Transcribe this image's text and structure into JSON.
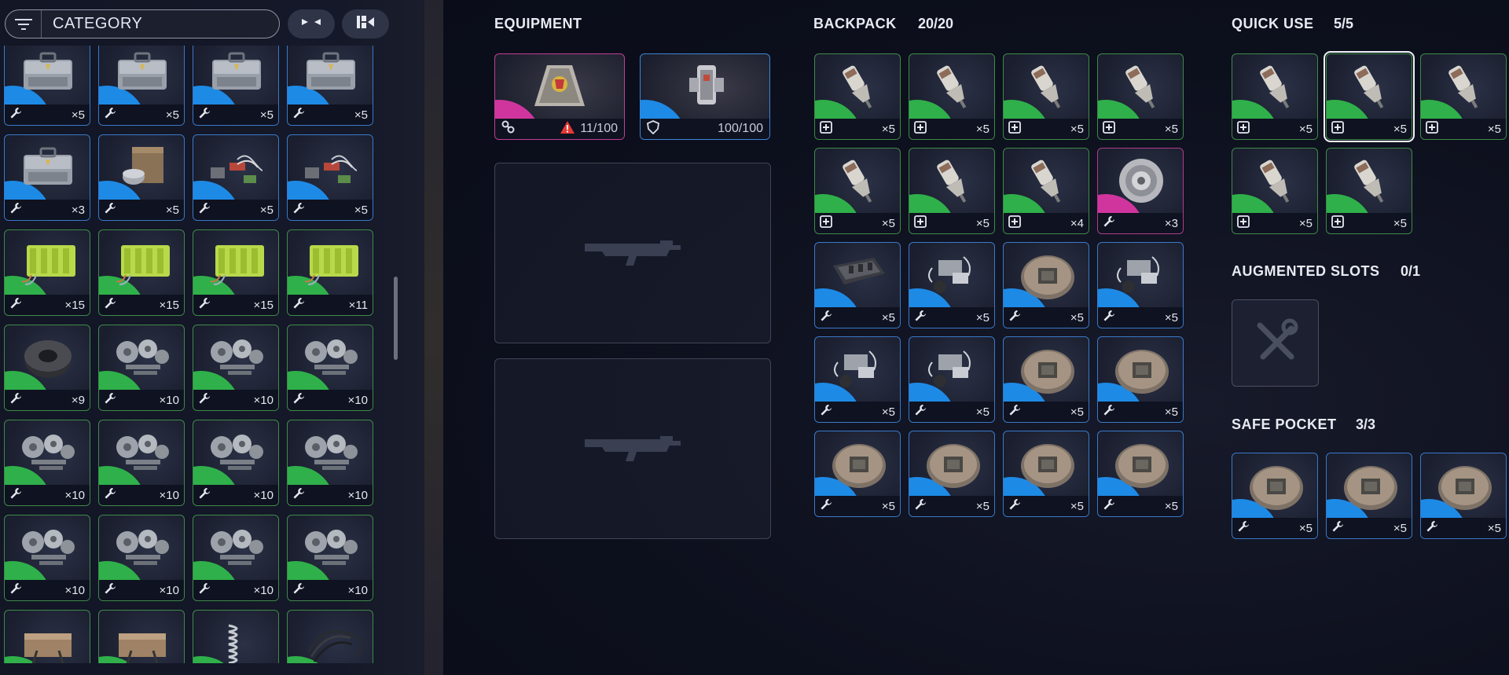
{
  "stash": {
    "category_label": "CATEGORY",
    "items": [
      {
        "rarity": "blue",
        "icon": "toolbox",
        "type": "wrench",
        "count": "×5"
      },
      {
        "rarity": "blue",
        "icon": "toolbox",
        "type": "wrench",
        "count": "×5"
      },
      {
        "rarity": "blue",
        "icon": "toolbox",
        "type": "wrench",
        "count": "×5"
      },
      {
        "rarity": "blue",
        "icon": "toolbox",
        "type": "wrench",
        "count": "×5"
      },
      {
        "rarity": "blue",
        "icon": "toolbox",
        "type": "wrench",
        "count": "×3"
      },
      {
        "rarity": "blue",
        "icon": "box-canister",
        "type": "wrench",
        "count": "×5"
      },
      {
        "rarity": "blue",
        "icon": "wires",
        "type": "wrench",
        "count": "×5"
      },
      {
        "rarity": "blue",
        "icon": "wires",
        "type": "wrench",
        "count": "×5"
      },
      {
        "rarity": "green",
        "icon": "battery",
        "type": "wrench",
        "count": "×15"
      },
      {
        "rarity": "green",
        "icon": "battery",
        "type": "wrench",
        "count": "×15"
      },
      {
        "rarity": "green",
        "icon": "battery",
        "type": "wrench",
        "count": "×15"
      },
      {
        "rarity": "green",
        "icon": "battery",
        "type": "wrench",
        "count": "×11"
      },
      {
        "rarity": "green",
        "icon": "tape",
        "type": "wrench",
        "count": "×9"
      },
      {
        "rarity": "green",
        "icon": "gears",
        "type": "wrench",
        "count": "×10"
      },
      {
        "rarity": "green",
        "icon": "gears",
        "type": "wrench",
        "count": "×10"
      },
      {
        "rarity": "green",
        "icon": "gears",
        "type": "wrench",
        "count": "×10"
      },
      {
        "rarity": "green",
        "icon": "gears",
        "type": "wrench",
        "count": "×10"
      },
      {
        "rarity": "green",
        "icon": "gears",
        "type": "wrench",
        "count": "×10"
      },
      {
        "rarity": "green",
        "icon": "gears",
        "type": "wrench",
        "count": "×10"
      },
      {
        "rarity": "green",
        "icon": "gears",
        "type": "wrench",
        "count": "×10"
      },
      {
        "rarity": "green",
        "icon": "gears",
        "type": "wrench",
        "count": "×10"
      },
      {
        "rarity": "green",
        "icon": "gears",
        "type": "wrench",
        "count": "×10"
      },
      {
        "rarity": "green",
        "icon": "gears",
        "type": "wrench",
        "count": "×10"
      },
      {
        "rarity": "green",
        "icon": "gears",
        "type": "wrench",
        "count": "×10"
      },
      {
        "rarity": "green",
        "icon": "bag",
        "type": "none",
        "count": ""
      },
      {
        "rarity": "green",
        "icon": "bag",
        "type": "none",
        "count": ""
      },
      {
        "rarity": "green",
        "icon": "spring",
        "type": "none",
        "count": ""
      },
      {
        "rarity": "green",
        "icon": "cables",
        "type": "none",
        "count": ""
      }
    ]
  },
  "equipment": {
    "title": "EQUIPMENT",
    "augment": {
      "value": "11/100"
    },
    "shield": {
      "value": "100/100"
    }
  },
  "backpack": {
    "title": "BACKPACK",
    "count": "20/20",
    "items": [
      {
        "rarity": "green",
        "icon": "injector",
        "type": "med",
        "count": "×5"
      },
      {
        "rarity": "green",
        "icon": "injector",
        "type": "med",
        "count": "×5"
      },
      {
        "rarity": "green",
        "icon": "injector",
        "type": "med",
        "count": "×5"
      },
      {
        "rarity": "green",
        "icon": "injector",
        "type": "med",
        "count": "×5"
      },
      {
        "rarity": "green",
        "icon": "injector",
        "type": "med",
        "count": "×5"
      },
      {
        "rarity": "green",
        "icon": "injector",
        "type": "med",
        "count": "×5"
      },
      {
        "rarity": "green",
        "icon": "injector",
        "type": "med",
        "count": "×4"
      },
      {
        "rarity": "pink",
        "icon": "motor",
        "type": "wrench",
        "count": "×3"
      },
      {
        "rarity": "blue",
        "icon": "tray",
        "type": "wrench",
        "count": "×5"
      },
      {
        "rarity": "blue",
        "icon": "parts",
        "type": "wrench",
        "count": "×5"
      },
      {
        "rarity": "blue",
        "icon": "chipdisk",
        "type": "wrench",
        "count": "×5"
      },
      {
        "rarity": "blue",
        "icon": "parts",
        "type": "wrench",
        "count": "×5"
      },
      {
        "rarity": "blue",
        "icon": "parts",
        "type": "wrench",
        "count": "×5"
      },
      {
        "rarity": "blue",
        "icon": "parts",
        "type": "wrench",
        "count": "×5"
      },
      {
        "rarity": "blue",
        "icon": "chipdisk",
        "type": "wrench",
        "count": "×5"
      },
      {
        "rarity": "blue",
        "icon": "chipdisk",
        "type": "wrench",
        "count": "×5"
      },
      {
        "rarity": "blue",
        "icon": "chipdisk",
        "type": "wrench",
        "count": "×5"
      },
      {
        "rarity": "blue",
        "icon": "chipdisk",
        "type": "wrench",
        "count": "×5"
      },
      {
        "rarity": "blue",
        "icon": "chipdisk",
        "type": "wrench",
        "count": "×5"
      },
      {
        "rarity": "blue",
        "icon": "chipdisk",
        "type": "wrench",
        "count": "×5"
      }
    ]
  },
  "quick_use": {
    "title": "QUICK USE",
    "count": "5/5",
    "items": [
      {
        "rarity": "green",
        "icon": "injector",
        "type": "med",
        "count": "×5"
      },
      {
        "rarity": "green",
        "icon": "injector",
        "type": "med",
        "count": "×5",
        "selected": true
      },
      {
        "rarity": "green",
        "icon": "injector",
        "type": "med",
        "count": "×5"
      },
      {
        "rarity": "green",
        "icon": "injector",
        "type": "med",
        "count": "×5"
      },
      {
        "rarity": "green",
        "icon": "injector",
        "type": "med",
        "count": "×5"
      }
    ]
  },
  "augmented": {
    "title": "AUGMENTED SLOTS",
    "count": "0/1"
  },
  "safe_pocket": {
    "title": "SAFE POCKET",
    "count": "3/3",
    "items": [
      {
        "rarity": "blue",
        "icon": "chipdisk",
        "type": "wrench",
        "count": "×5"
      },
      {
        "rarity": "blue",
        "icon": "chipdisk",
        "type": "wrench",
        "count": "×5"
      },
      {
        "rarity": "blue",
        "icon": "chipdisk",
        "type": "wrench",
        "count": "×5"
      }
    ]
  },
  "colors": {
    "green": "#2fb04a",
    "blue": "#1d8ae6",
    "pink": "#d0359e",
    "warning": "#e53935"
  }
}
